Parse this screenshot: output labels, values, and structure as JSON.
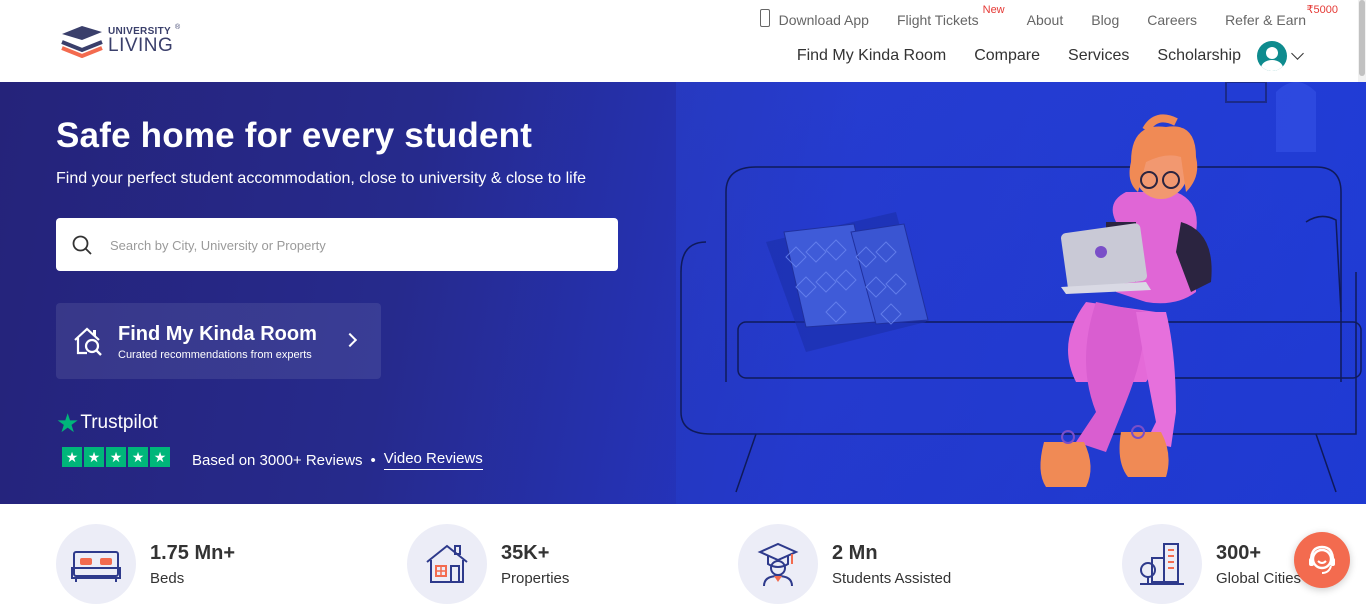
{
  "brand": {
    "top": "UNIVERSITY",
    "main": "LIVING",
    "reg": "®"
  },
  "toplinks": [
    {
      "label": "Download App"
    },
    {
      "label": "Flight Tickets",
      "badge": "New"
    },
    {
      "label": "About"
    },
    {
      "label": "Blog"
    },
    {
      "label": "Careers"
    },
    {
      "label": "Refer & Earn",
      "badge": "₹5000"
    }
  ],
  "mainnav": [
    "Find My Kinda Room",
    "Compare",
    "Services",
    "Scholarship"
  ],
  "hero": {
    "title": "Safe home for every student",
    "subtitle": "Find your perfect student accommodation, close to university & close to life",
    "search_placeholder": "Search by City, University or Property",
    "kinda_title": "Find My Kinda Room",
    "kinda_sub": "Curated recommendations from experts",
    "trustpilot": "Trustpilot",
    "reviews_text": "Based on 3000+ Reviews",
    "reviews_sep": "•",
    "video_reviews": "Video Reviews"
  },
  "stats": [
    {
      "value": "1.75 Mn+",
      "label": "Beds",
      "icon": "bed-icon"
    },
    {
      "value": "35K+",
      "label": "Properties",
      "icon": "building-icon"
    },
    {
      "value": "2 Mn",
      "label": "Students Assisted",
      "icon": "graduate-icon"
    },
    {
      "value": "300+",
      "label": "Global Cities",
      "icon": "city-icon"
    }
  ],
  "colors": {
    "accent": "#f36b4f",
    "hero": "#2436c9",
    "trustpilot": "#00b67a"
  }
}
